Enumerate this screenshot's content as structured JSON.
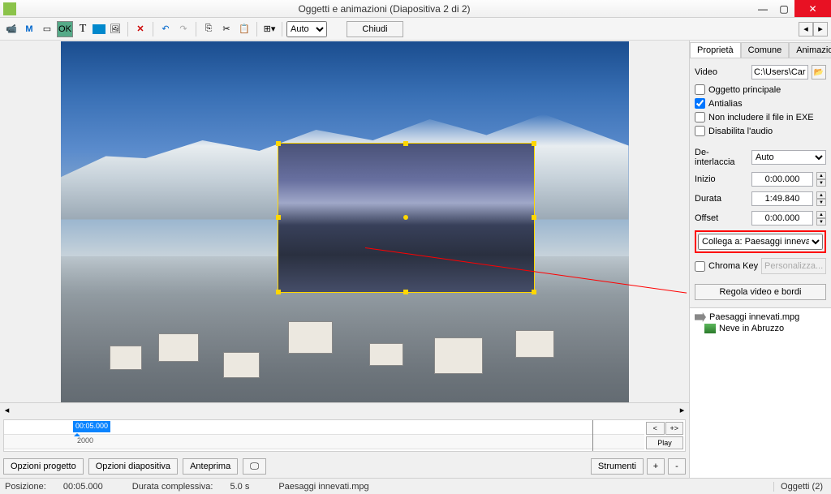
{
  "window": {
    "title": "Oggetti e animazioni  (Diapositiva 2 di 2)"
  },
  "toolbar": {
    "auto": "Auto",
    "close": "Chiudi"
  },
  "tabs": {
    "properties": "Proprietà",
    "common": "Comune",
    "animation": "Animazione"
  },
  "props": {
    "video_label": "Video",
    "video_path": "C:\\Users\\Carmelo\\\\",
    "main_object": "Oggetto principale",
    "antialias": "Antialias",
    "no_exe": "Non includere il file in EXE",
    "mute": "Disabilita l'audio",
    "deinterlace_label": "De-interlaccia",
    "deinterlace_val": "Auto",
    "start_label": "Inizio",
    "start_val": "0:00.000",
    "duration_label": "Durata",
    "duration_val": "1:49.840",
    "offset_label": "Offset",
    "offset_val": "0:00.000",
    "link_label": "Collega a: Paesaggi innevati....",
    "chroma": "Chroma Key",
    "customize": "Personalizza...",
    "adjust": "Regola video e bordi"
  },
  "objects": {
    "video": "Paesaggi innevati.mpg",
    "image": "Neve in Abruzzo"
  },
  "timeline": {
    "keyframe": "00:05.000",
    "marker2": "2000",
    "play": "Play",
    "back": "<",
    "fwd": "+>"
  },
  "bottom": {
    "proj": "Opzioni progetto",
    "slide": "Opzioni diapositiva",
    "preview": "Anteprima",
    "tools": "Strumenti",
    "plus": "+",
    "minus": "-"
  },
  "status": {
    "pos_label": "Posizione:",
    "pos_val": "00:05.000",
    "dur_label": "Durata complessiva:",
    "dur_val": "5.0 s",
    "file": "Paesaggi innevati.mpg",
    "objects": "Oggetti (2)"
  }
}
